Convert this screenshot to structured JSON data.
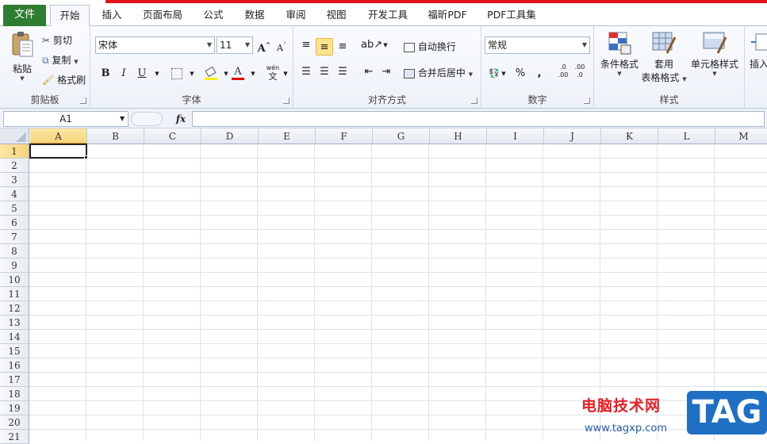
{
  "tabs": {
    "file": "文件",
    "items": [
      {
        "label": "开始",
        "active": true
      },
      {
        "label": "插入"
      },
      {
        "label": "页面布局"
      },
      {
        "label": "公式"
      },
      {
        "label": "数据"
      },
      {
        "label": "审阅"
      },
      {
        "label": "视图"
      },
      {
        "label": "开发工具"
      },
      {
        "label": "福昕PDF"
      },
      {
        "label": "PDF工具集"
      }
    ]
  },
  "ribbon": {
    "clipboard": {
      "label": "剪贴板",
      "paste": "粘贴",
      "cut": "剪切",
      "copy": "复制",
      "format_painter": "格式刷"
    },
    "font": {
      "label": "字体",
      "font_name": "宋体",
      "font_size": "11",
      "bold": "B",
      "italic": "I",
      "underline": "U",
      "font_color_letter": "A",
      "phonetic": "wén",
      "phonetic_char": "文"
    },
    "alignment": {
      "label": "对齐方式",
      "wrap_text": "自动换行",
      "merge_center": "合并后居中"
    },
    "number": {
      "label": "数字",
      "format": "常规",
      "percent": "%",
      "comma": ",",
      "inc_decimal": ".0 .00",
      "dec_decimal": ".00 .0"
    },
    "styles": {
      "label": "样式",
      "conditional": "条件格式",
      "table_format_1": "套用",
      "table_format_2": "表格格式",
      "cell_styles": "单元格样式"
    },
    "cells": {
      "insert": "插入"
    }
  },
  "formula_bar": {
    "name_box": "A1",
    "fx": "fx",
    "formula": ""
  },
  "grid": {
    "columns": [
      "A",
      "B",
      "C",
      "D",
      "E",
      "F",
      "G",
      "H",
      "I",
      "J",
      "K",
      "L",
      "M"
    ],
    "rows": [
      "1",
      "2",
      "3",
      "4",
      "5",
      "6",
      "7",
      "8",
      "9",
      "10",
      "11",
      "12",
      "13",
      "14",
      "15",
      "16",
      "17",
      "18",
      "19",
      "20",
      "21"
    ],
    "active_cell": "A1"
  },
  "watermark": {
    "text": "电脑技术网",
    "url": "www.tagxp.com",
    "badge": "TAG"
  },
  "colors": {
    "file_tab": "#2e7d32",
    "accent_red": "#e3141b",
    "selection_highlight": "#fde48c"
  }
}
